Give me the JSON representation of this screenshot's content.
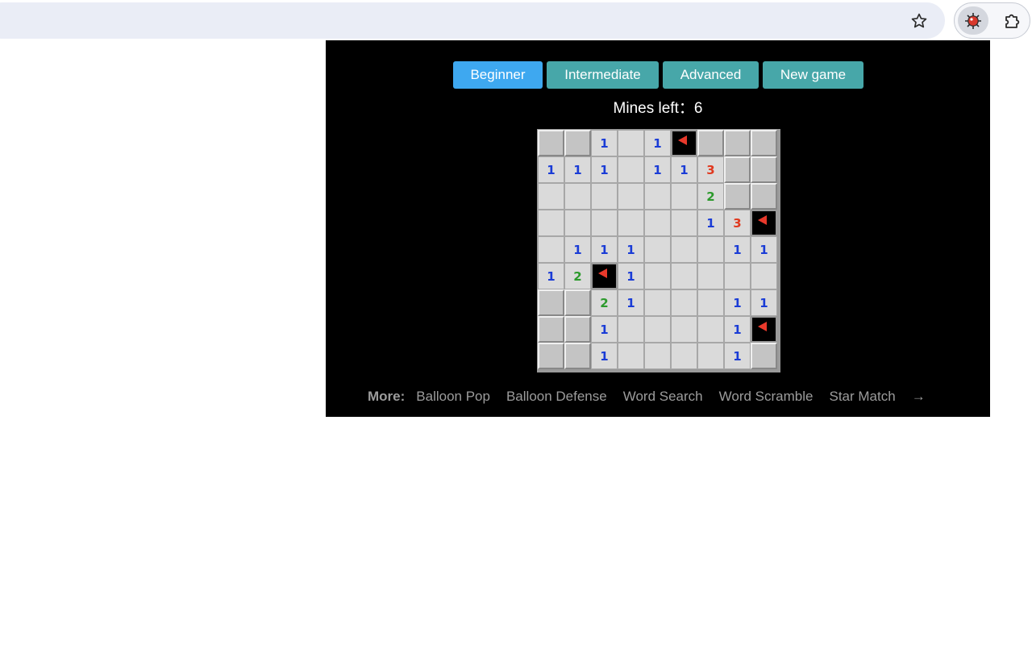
{
  "browser": {
    "icons": {
      "bookmark": "star-icon",
      "extension": "minesweeper-icon",
      "extensions_menu": "puzzle-icon"
    }
  },
  "game": {
    "modes": [
      {
        "id": "beginner",
        "label": "Beginner",
        "active": true
      },
      {
        "id": "intermediate",
        "label": "Intermediate",
        "active": false
      },
      {
        "id": "advanced",
        "label": "Advanced",
        "active": false
      }
    ],
    "new_game_label": "New game",
    "mines_left_label": "Mines left：",
    "mines_left_value": "6",
    "colors": {
      "active_mode": "#3ea8f0",
      "mode": "#47a7a9",
      "n1": "#1a3cd6",
      "n2": "#2c9a2c",
      "n3": "#e0391f",
      "flag": "#e8392b"
    },
    "board": [
      [
        "H",
        "H",
        "1",
        "O",
        "1",
        "F",
        "H",
        "H",
        "H"
      ],
      [
        "1",
        "1",
        "1",
        "O",
        "1",
        "1",
        "3",
        "H",
        "H"
      ],
      [
        "O",
        "O",
        "O",
        "O",
        "O",
        "O",
        "2",
        "H",
        "H"
      ],
      [
        "O",
        "O",
        "O",
        "O",
        "O",
        "O",
        "1",
        "3",
        "F"
      ],
      [
        "O",
        "1",
        "1",
        "1",
        "O",
        "O",
        "O",
        "1",
        "1"
      ],
      [
        "1",
        "2",
        "F",
        "1",
        "O",
        "O",
        "O",
        "O",
        "O"
      ],
      [
        "H",
        "H",
        "2",
        "1",
        "O",
        "O",
        "O",
        "1",
        "1"
      ],
      [
        "H",
        "H",
        "1",
        "O",
        "O",
        "O",
        "O",
        "1",
        "F"
      ],
      [
        "H",
        "H",
        "1",
        "O",
        "O",
        "O",
        "O",
        "1",
        "H"
      ]
    ]
  },
  "more": {
    "label": "More:",
    "links": [
      "Balloon Pop",
      "Balloon Defense",
      "Word Search",
      "Word Scramble",
      "Star Match"
    ],
    "arrow": "→"
  }
}
